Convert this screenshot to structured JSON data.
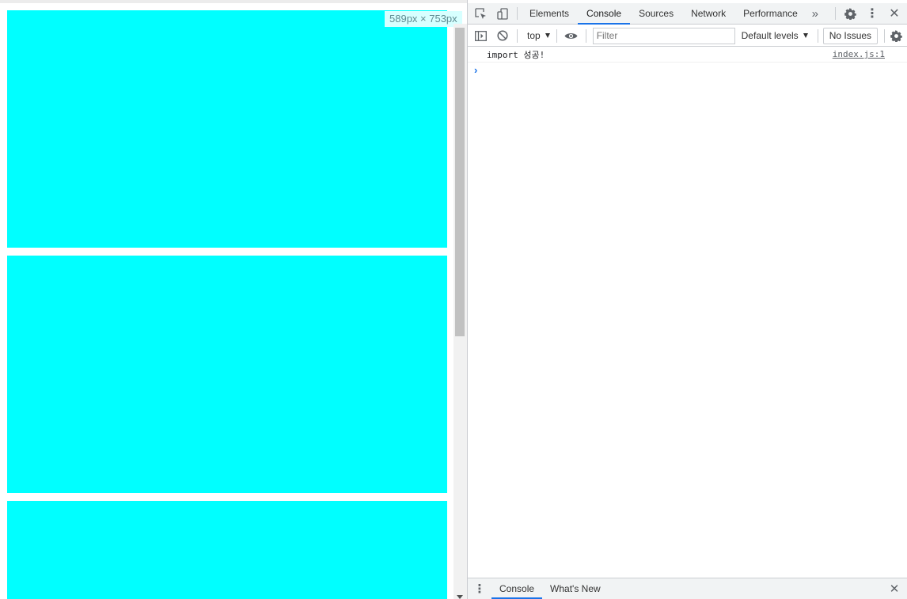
{
  "viewport": {
    "size_label": "589px × 753px",
    "box_color": "#00ffff",
    "boxes": [
      "box-1",
      "box-2",
      "box-3"
    ]
  },
  "devtools": {
    "tabs": [
      {
        "label": "Elements",
        "active": false
      },
      {
        "label": "Console",
        "active": true
      },
      {
        "label": "Sources",
        "active": false
      },
      {
        "label": "Network",
        "active": false
      },
      {
        "label": "Performance",
        "active": false
      }
    ],
    "more_tabs_icon": "double-chevron-icon",
    "accent_color": "#1a73e8"
  },
  "console_toolbar": {
    "context": "top",
    "filter_placeholder": "Filter",
    "filter_value": "",
    "levels": "Default levels",
    "issues": "No Issues"
  },
  "console": {
    "messages": [
      {
        "text": "import 성공!",
        "source": "index.js:1"
      }
    ],
    "prompt": "›"
  },
  "drawer": {
    "tabs": [
      {
        "label": "Console",
        "active": true
      },
      {
        "label": "What's New",
        "active": false
      }
    ]
  }
}
